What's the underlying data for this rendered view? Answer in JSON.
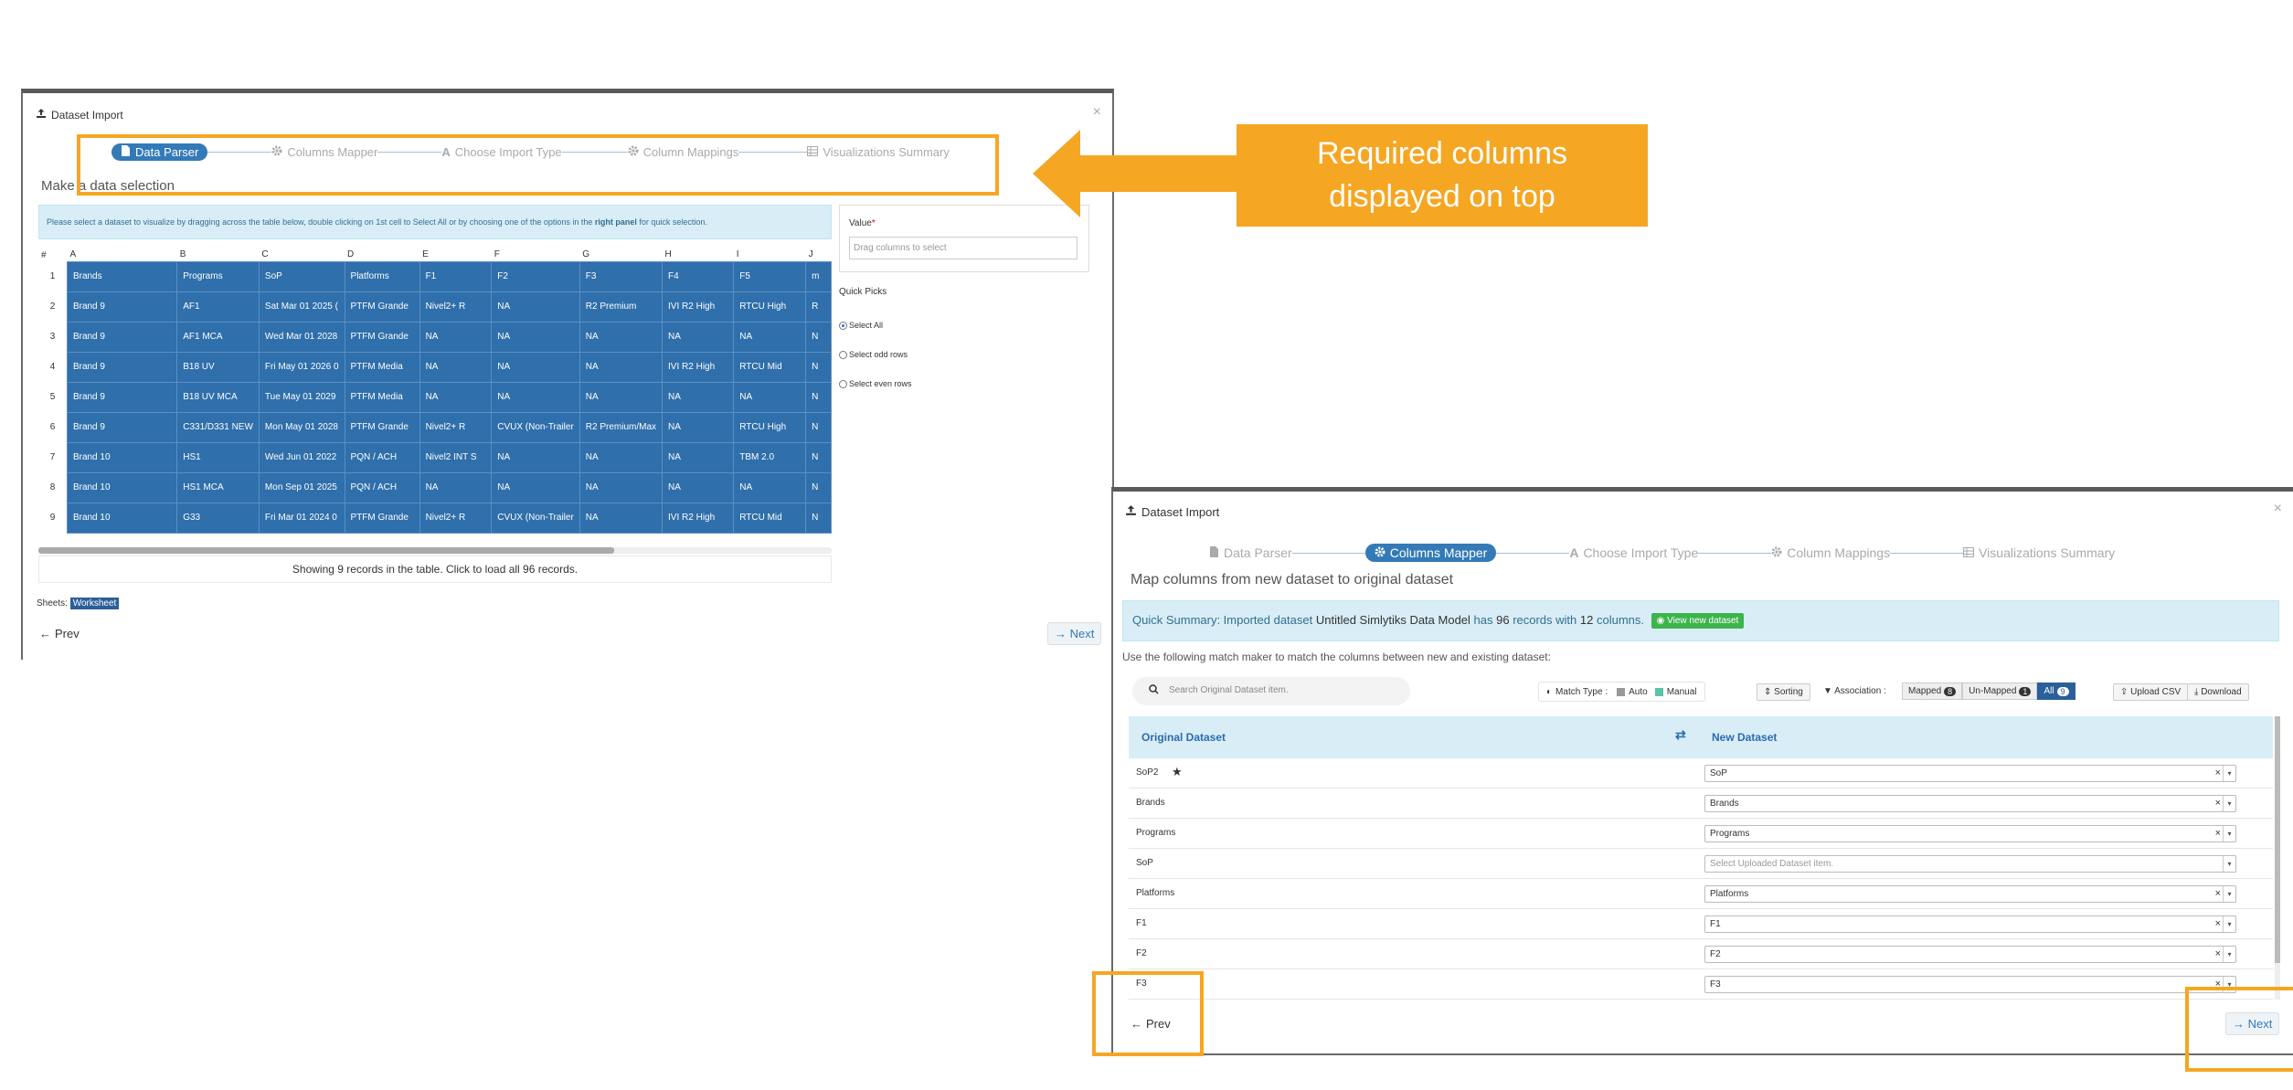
{
  "callout": {
    "line1": "Required columns",
    "line2": "displayed on top",
    "color": "#f5a623"
  },
  "dialog1": {
    "title": "Dataset Import",
    "close": "×",
    "steps": [
      {
        "label": "Data Parser",
        "icon": "file-icon",
        "active": true
      },
      {
        "label": "Columns Mapper",
        "icon": "gear-icon",
        "active": false
      },
      {
        "label": "Choose Import Type",
        "icon": "text-a-icon",
        "active": false
      },
      {
        "label": "Column Mappings",
        "icon": "gear-icon",
        "active": false
      },
      {
        "label": "Visualizations Summary",
        "icon": "table-icon",
        "active": false
      }
    ],
    "heading": "Make a data selection",
    "info_pre": "Please select a dataset to visualize by dragging across the table below, double clicking on 1st cell to Select All or by choosing one of the options in the ",
    "info_bold": "right panel",
    "info_post": " for quick selection.",
    "columns": [
      "#",
      "A",
      "B",
      "C",
      "D",
      "E",
      "F",
      "G",
      "H",
      "I",
      "J"
    ],
    "rows": [
      [
        "1",
        "Brands",
        "Programs",
        "SoP",
        "Platforms",
        "F1",
        "F2",
        "F3",
        "F4",
        "F5",
        "m"
      ],
      [
        "2",
        "Brand 9",
        "AF1",
        "Sat Mar 01 2025 (",
        "PTFM Grande",
        "Nivel2+ R",
        "NA",
        "R2 Premium",
        "IVI R2 High",
        "RTCU High",
        "R"
      ],
      [
        "3",
        "Brand 9",
        "AF1 MCA",
        "Wed Mar 01 2028",
        "PTFM Grande",
        "NA",
        "NA",
        "NA",
        "NA",
        "NA",
        "N"
      ],
      [
        "4",
        "Brand 9",
        "B18 UV",
        "Fri May 01 2026 0",
        "PTFM Media",
        "NA",
        "NA",
        "NA",
        "IVI R2 High",
        "RTCU Mid",
        "N"
      ],
      [
        "5",
        "Brand 9",
        "B18 UV MCA",
        "Tue May 01 2029",
        "PTFM Media",
        "NA",
        "NA",
        "NA",
        "NA",
        "NA",
        "N"
      ],
      [
        "6",
        "Brand 9",
        "C331/D331 NEW",
        "Mon May 01 2028",
        "PTFM Grande",
        "Nivel2+ R",
        "CVUX (Non-Trailer",
        "R2 Premium/Max",
        "NA",
        "RTCU High",
        "N"
      ],
      [
        "7",
        "Brand 10",
        "HS1",
        "Wed Jun 01 2022",
        "PQN / ACH",
        "Nivel2 INT S",
        "NA",
        "NA",
        "NA",
        "TBM 2.0",
        "N"
      ],
      [
        "8",
        "Brand 10",
        "HS1 MCA",
        "Mon Sep 01 2025",
        "PQN / ACH",
        "NA",
        "NA",
        "NA",
        "NA",
        "NA",
        "N"
      ],
      [
        "9",
        "Brand 10",
        "G33",
        "Fri Mar 01 2024 0",
        "PTFM Grande",
        "Nivel2+ R",
        "CVUX (Non-Trailer",
        "NA",
        "IVI R2 High",
        "RTCU Mid",
        "N"
      ]
    ],
    "showing": "Showing 9 records in the table. Click to load all 96 records.",
    "value_label": "Value",
    "value_placeholder": "Drag columns to select",
    "quick_picks": "Quick Picks",
    "picks": [
      "Select All",
      "Select odd rows",
      "Select even rows"
    ],
    "sheets_label": "Sheets:",
    "sheet_tab": "Worksheet",
    "prev": "Prev",
    "next": "Next"
  },
  "dialog2": {
    "title": "Dataset Import",
    "close": "×",
    "steps": [
      {
        "label": "Data Parser",
        "icon": "file-icon",
        "active": false
      },
      {
        "label": "Columns Mapper",
        "icon": "gear-icon",
        "active": true
      },
      {
        "label": "Choose Import Type",
        "icon": "text-a-icon",
        "active": false
      },
      {
        "label": "Column Mappings",
        "icon": "gear-icon",
        "active": false
      },
      {
        "label": "Visualizations Summary",
        "icon": "table-icon",
        "active": false
      }
    ],
    "heading": "Map columns from new dataset to original dataset",
    "summary_prefix": "Quick Summary: Imported dataset ",
    "summary_name": "Untitled Simlytiks Data Model",
    "summary_mid": " has ",
    "summary_records": "96",
    "summary_mid2": " records with ",
    "summary_cols": "12",
    "summary_suffix": " columns.",
    "view_btn": "View new dataset",
    "instructions": "Use the following match maker to match the columns between new and existing dataset:",
    "search_placeholder": "Search Original Dataset item.",
    "match_type_label": "Match Type :",
    "auto": "Auto",
    "manual": "Manual",
    "sorting": "Sorting",
    "association": "Association :",
    "mapped": "Mapped",
    "mapped_count": "8",
    "unmapped": "Un-Mapped",
    "unmapped_count": "1",
    "all": "All",
    "all_count": "9",
    "upload_csv": "Upload CSV",
    "download": "Download",
    "col_original": "Original Dataset",
    "col_new": "New Dataset",
    "rows": [
      {
        "original": "SoP2",
        "star": true,
        "new": "SoP",
        "placeholder": false
      },
      {
        "original": "Brands",
        "star": false,
        "new": "Brands",
        "placeholder": false
      },
      {
        "original": "Programs",
        "star": false,
        "new": "Programs",
        "placeholder": false
      },
      {
        "original": "SoP",
        "star": false,
        "new": "Select Uploaded Dataset item.",
        "placeholder": true
      },
      {
        "original": "Platforms",
        "star": false,
        "new": "Platforms",
        "placeholder": false
      },
      {
        "original": "F1",
        "star": false,
        "new": "F1",
        "placeholder": false
      },
      {
        "original": "F2",
        "star": false,
        "new": "F2",
        "placeholder": false
      },
      {
        "original": "F3",
        "star": false,
        "new": "F3",
        "placeholder": false
      }
    ],
    "prev": "Prev",
    "next": "Next"
  }
}
